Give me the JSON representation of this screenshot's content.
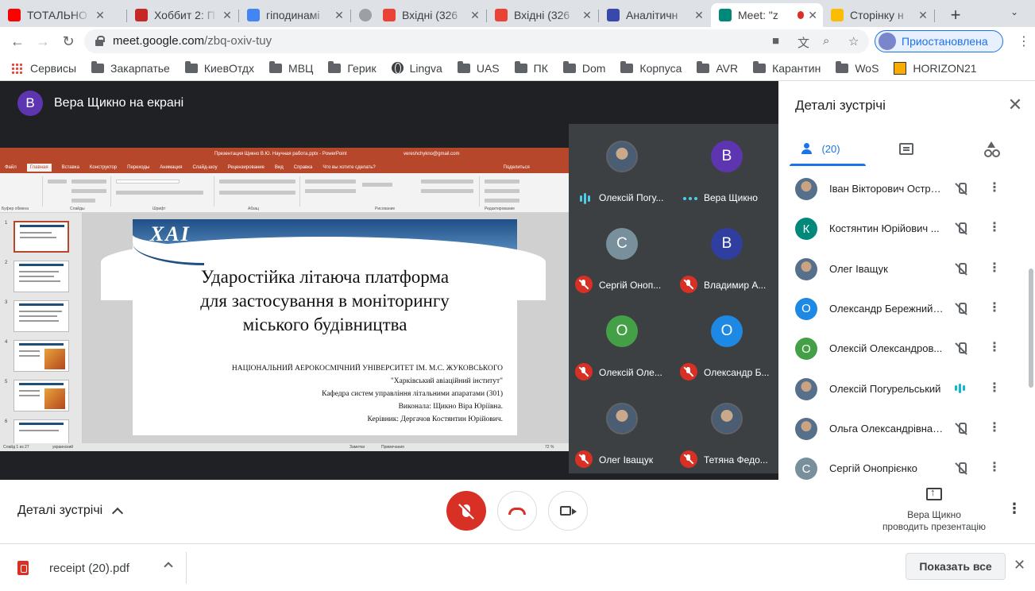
{
  "browser": {
    "tabs": [
      {
        "title": "ТОТАЛЬНО",
        "favicon": "youtube-icon",
        "color": "#ff0000"
      },
      {
        "title": "Хоббит 2: П",
        "favicon": "kinopoisk-icon",
        "color": "#c62828"
      },
      {
        "title": "гіподинамі",
        "favicon": "google-icon",
        "color": "#4285f4"
      },
      {
        "title": "",
        "favicon": "loading-icon",
        "color": "#9aa0a6"
      },
      {
        "title": "Вхідні (326",
        "favicon": "gmail-icon",
        "color": "#ea4335"
      },
      {
        "title": "Вхідні (326",
        "favicon": "gmail-icon",
        "color": "#ea4335"
      },
      {
        "title": "Аналітичн",
        "favicon": "plane-icon",
        "color": "#3949ab"
      },
      {
        "title": "Meet: \"z",
        "favicon": "meet-icon",
        "color": "#00897b",
        "active": true
      },
      {
        "title": "Сторінку н",
        "favicon": "drive-icon",
        "color": "#fbbc04"
      }
    ],
    "new_tab": "+",
    "url_host": "meet.google.com",
    "url_path": "/zbq-oxiv-tuy",
    "profile_label": "Приостановлена",
    "bookmarks": [
      {
        "label": "Сервисы",
        "icon": "apps-icon"
      },
      {
        "label": "Закарпатье",
        "icon": "folder-icon"
      },
      {
        "label": "КиевОтдх",
        "icon": "folder-icon"
      },
      {
        "label": "МВЦ",
        "icon": "folder-icon"
      },
      {
        "label": "Герик",
        "icon": "folder-icon"
      },
      {
        "label": "Lingva",
        "icon": "globe-icon"
      },
      {
        "label": "UAS",
        "icon": "folder-icon"
      },
      {
        "label": "ПК",
        "icon": "folder-icon"
      },
      {
        "label": "Dom",
        "icon": "folder-icon"
      },
      {
        "label": "Корпуса",
        "icon": "folder-icon"
      },
      {
        "label": "AVR",
        "icon": "folder-icon"
      },
      {
        "label": "Карантин",
        "icon": "folder-icon"
      },
      {
        "label": "WoS",
        "icon": "folder-icon"
      },
      {
        "label": "HORIZON21",
        "icon": "horizon-icon"
      }
    ]
  },
  "meet": {
    "presenter_initial": "В",
    "presenter_label": "Вера Щикно на екрані",
    "presentation": {
      "window_title": "Презентация Щикно В.Ю. Научная работа.pptx - PowerPoint",
      "user_email": "vereshchykno@gmail.com",
      "menu": [
        "Файл",
        "Главная",
        "Вставка",
        "Конструктор",
        "Переходы",
        "Анимация",
        "Слайд-шоу",
        "Рецензирование",
        "Вид",
        "Справка",
        "Что вы хотите сделать?",
        "Поделиться"
      ],
      "ribbon_groups": [
        "Буфер обмена",
        "Слайды",
        "Шрифт",
        "Абзац",
        "Рисование",
        "Редактирование"
      ],
      "status_left": "Слайд 1 из 27",
      "status_lang": "украинский",
      "status_notes": "Заметки",
      "status_comments": "Примечания",
      "zoom": "72 %",
      "slide_numbers": [
        "1",
        "2",
        "3",
        "4",
        "5",
        "6"
      ],
      "slide": {
        "logo": "ХАІ",
        "title_lines": [
          "Ударостійка літаюча платформа",
          "для застосування в моніторингу",
          "міського будівництва"
        ],
        "university": "НАЦІОНАЛЬНИЙ АЕРОКОСМІЧНИЙ УНІВЕРСИТЕТ ІМ. М.С. ЖУКОВСЬКОГО",
        "institute": "\"Харківський авіаційний інститут\"",
        "department": "Кафедра систем управління літальними апаратами (301)",
        "author": "Виконала: Щикно Віра Юріївна.",
        "supervisor": "Керівник: Дергачов Костянтин Юрійович."
      }
    },
    "tiles": [
      {
        "name": "Олексій Погу...",
        "initial": "",
        "color": "#4a5d73",
        "status": "talking"
      },
      {
        "name": "Вера Щикно",
        "initial": "В",
        "color": "#5e35b1",
        "status": "dots"
      },
      {
        "name": "Сергій Оноп...",
        "initial": "С",
        "color": "#78909c",
        "status": "muted"
      },
      {
        "name": "Владимир А...",
        "initial": "В",
        "color": "#303f9f",
        "status": "muted"
      },
      {
        "name": "Олексій Оле...",
        "initial": "О",
        "color": "#43a047",
        "status": "muted"
      },
      {
        "name": "Олександр Б...",
        "initial": "О",
        "color": "#1e88e5",
        "status": "muted"
      },
      {
        "name": "Олег Іващук",
        "initial": "",
        "color": "#6d7f8f",
        "status": "muted"
      },
      {
        "name": "Тетяна Федо...",
        "initial": "",
        "color": "#5d4037",
        "status": "muted"
      }
    ],
    "panel": {
      "title": "Деталі зустрічі",
      "people_count": "(20)",
      "participants": [
        {
          "name": "Іван Вікторович Остро...",
          "initial": "",
          "color": "#5c6bc0",
          "status": "muted"
        },
        {
          "name": "Костянтин Юрійович ...",
          "initial": "К",
          "color": "#00897b",
          "status": "muted"
        },
        {
          "name": "Олег Іващук",
          "initial": "",
          "color": "#6d7f8f",
          "status": "muted"
        },
        {
          "name": "Олександр Бережний ...",
          "initial": "О",
          "color": "#1e88e5",
          "status": "muted"
        },
        {
          "name": "Олексій Олександров...",
          "initial": "О",
          "color": "#43a047",
          "status": "muted"
        },
        {
          "name": "Олексій Погурельський",
          "initial": "",
          "color": "#4a5d73",
          "status": "talking"
        },
        {
          "name": "Ольга Олександрівна ...",
          "initial": "",
          "color": "#7b8a5a",
          "status": "muted"
        },
        {
          "name": "Сергій Онопрієнко",
          "initial": "С",
          "color": "#78909c",
          "status": "muted"
        }
      ]
    },
    "controls": {
      "details_label": "Деталі зустрічі",
      "presenting_line1": "Вера Щикно",
      "presenting_line2": "проводить презентацію"
    }
  },
  "downloads": {
    "file": "receipt (20).pdf",
    "show_all": "Показать все"
  }
}
